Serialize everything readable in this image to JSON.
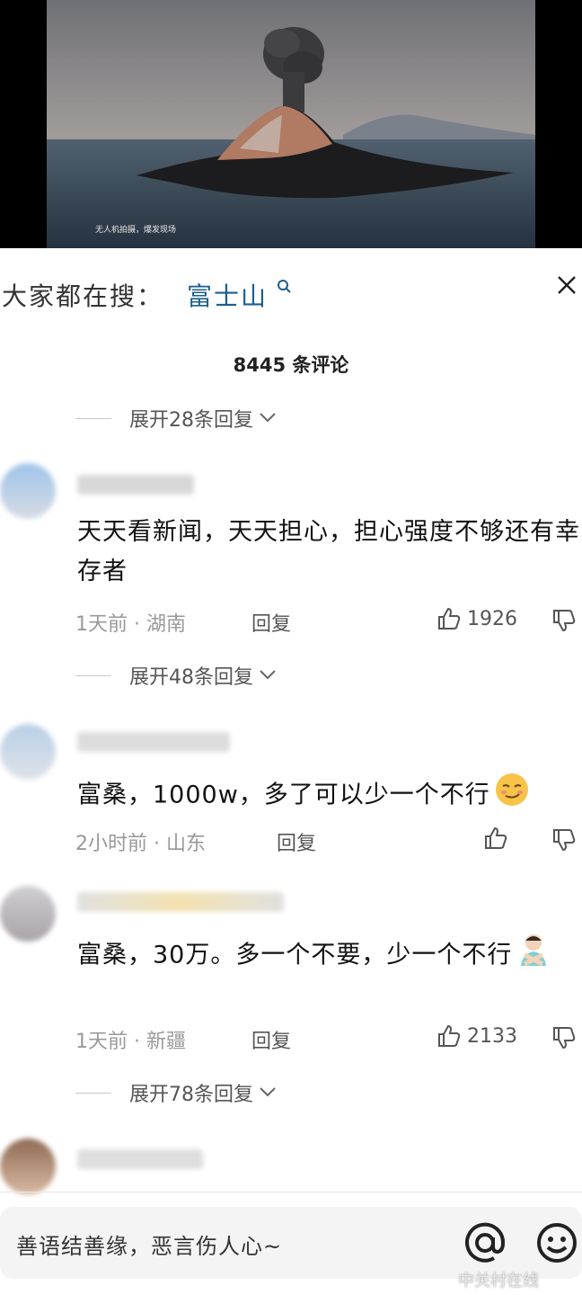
{
  "video": {
    "caption": "无人机拍摄，爆发现场"
  },
  "search": {
    "label": "大家都在搜：",
    "term": "富士山"
  },
  "comment_count": "8445 条评论",
  "expand_top": "展开28条回复",
  "comments": [
    {
      "text": "天天看新闻，天天担心，担心强度不够还有幸存者",
      "time": "1天前",
      "location": "湖南",
      "reply": "回复",
      "likes": "1926",
      "expand": "展开48条回复"
    },
    {
      "text": "富桑，1000w，多了可以少一个不行",
      "time": "2小时前",
      "location": "山东",
      "reply": "回复",
      "likes": ""
    },
    {
      "text": "富桑，30万。多一个不要，少一个不行",
      "time": "1天前",
      "location": "新疆",
      "reply": "回复",
      "likes": "2133",
      "expand": "展开78条回复"
    }
  ],
  "input": {
    "placeholder": "善语结善缘，恶言伤人心~"
  },
  "watermark": "中关村在线",
  "meta_separator": "·"
}
